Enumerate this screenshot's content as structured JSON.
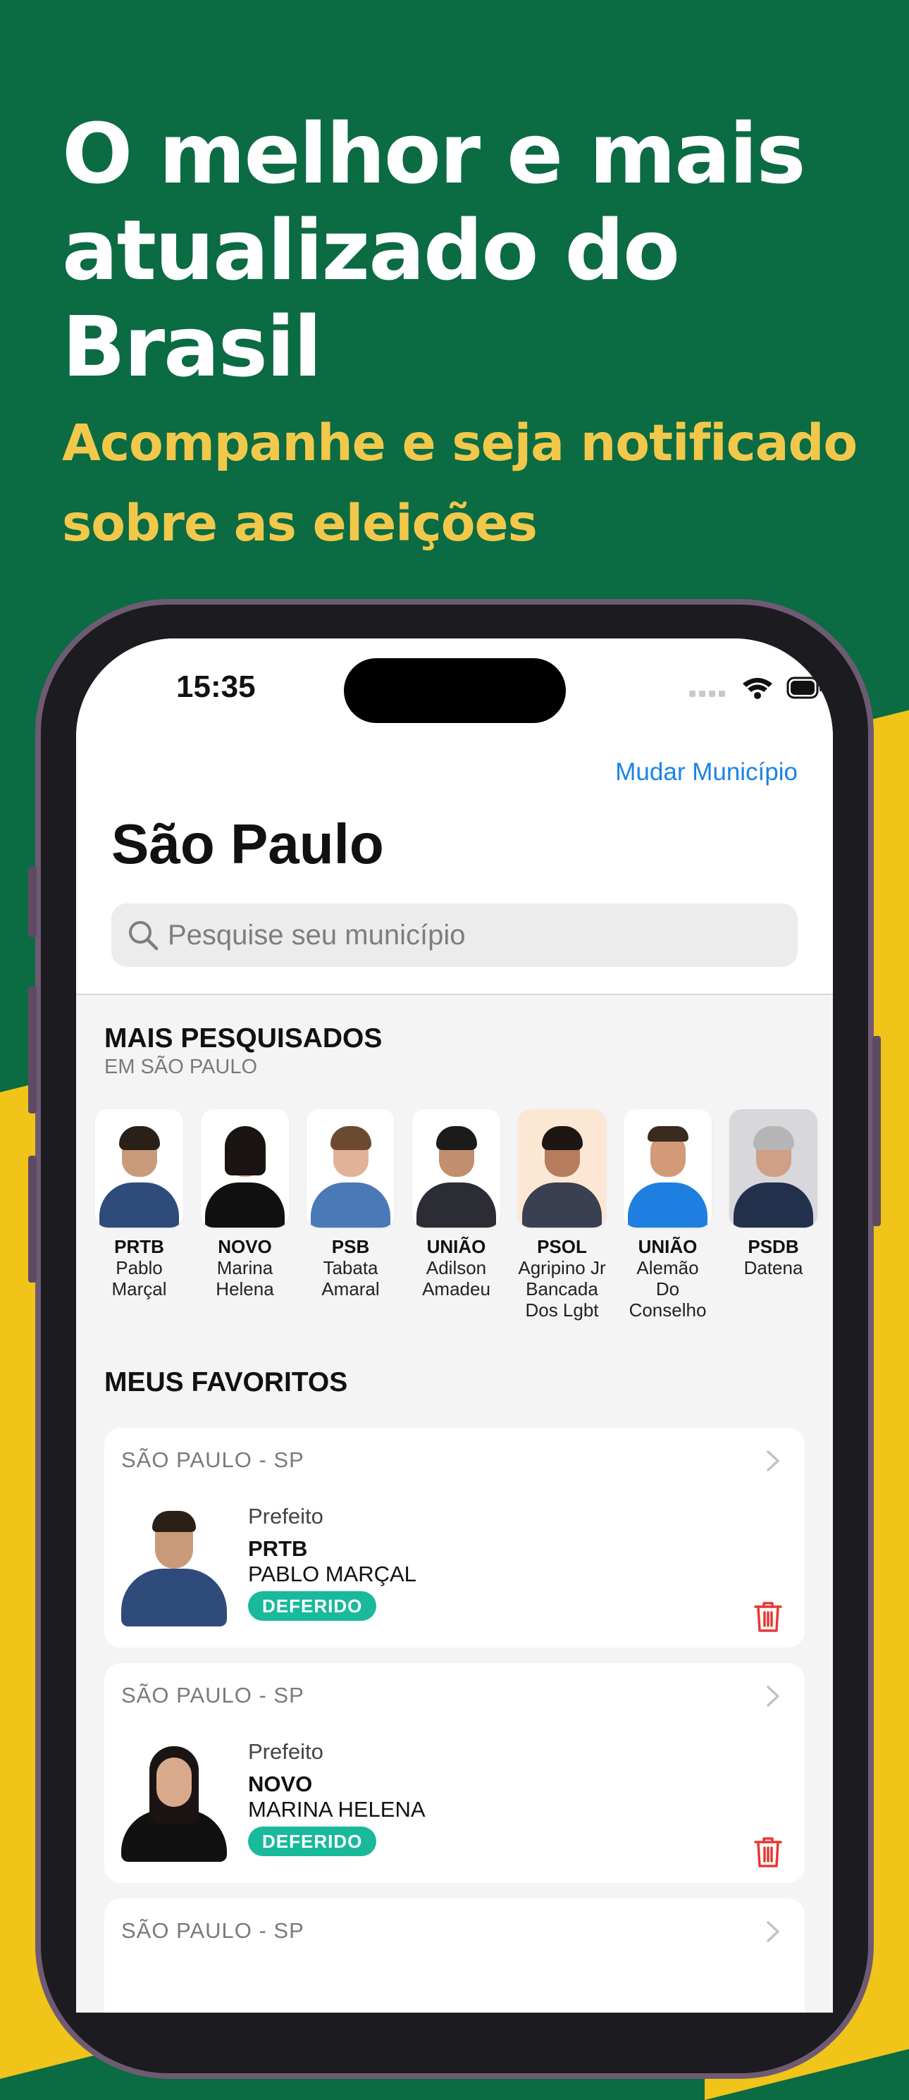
{
  "promo": {
    "headline": "O melhor e mais atualizado do Brasil",
    "subheadline": "Acompanhe e seja notificado sobre as eleições"
  },
  "status_bar": {
    "time": "15:35"
  },
  "header": {
    "change_city_link": "Mudar Município",
    "city_title": "São Paulo",
    "search_placeholder": "Pesquise seu município"
  },
  "most_searched": {
    "title": "MAIS PESQUISADOS",
    "subtitle": "EM SÃO PAULO",
    "candidates": [
      {
        "party": "PRTB",
        "name": "Pablo Marçal"
      },
      {
        "party": "NOVO",
        "name": "Marina Helena"
      },
      {
        "party": "PSB",
        "name": "Tabata Amaral"
      },
      {
        "party": "UNIÃO",
        "name": "Adilson Amadeu"
      },
      {
        "party": "PSOL",
        "name": "Agripino Jr Bancada Dos Lgbt"
      },
      {
        "party": "UNIÃO",
        "name": "Alemão Do Conselho"
      },
      {
        "party": "PSDB",
        "name": "Datena"
      }
    ]
  },
  "favorites": {
    "title": "MEUS FAVORITOS",
    "items": [
      {
        "location": "SÃO PAULO - SP",
        "role": "Prefeito",
        "party": "PRTB",
        "name": "PABLO MARÇAL",
        "status": "DEFERIDO"
      },
      {
        "location": "SÃO PAULO - SP",
        "role": "Prefeito",
        "party": "NOVO",
        "name": "MARINA HELENA",
        "status": "DEFERIDO"
      },
      {
        "location": "SÃO PAULO - SP"
      }
    ]
  },
  "colors": {
    "brand_green": "#0b6b43",
    "brand_yellow": "#f0c419",
    "link_blue": "#1b83e6",
    "badge_green": "#19b99c",
    "delete_red": "#e53935"
  }
}
